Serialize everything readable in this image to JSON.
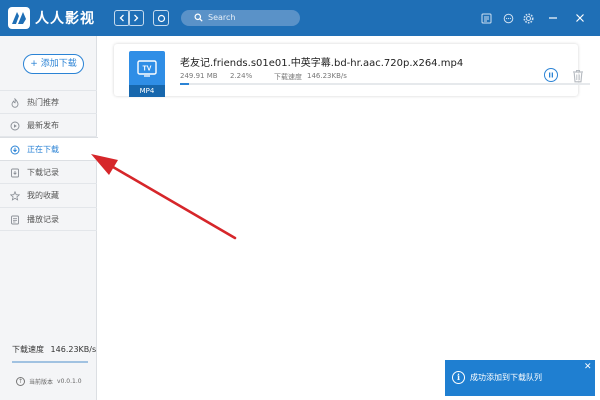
{
  "app": {
    "title": "人人影视"
  },
  "titlebar": {
    "search_placeholder": "Search",
    "icons": [
      "back-icon",
      "forward-icon",
      "refresh-icon",
      "search-icon",
      "download-history-icon",
      "message-icon",
      "settings-icon",
      "minimize-icon",
      "close-icon"
    ]
  },
  "sidebar": {
    "add_download": "+ 添加下载",
    "items": [
      {
        "label": "热门推荐",
        "icon": "flame-icon"
      },
      {
        "label": "最新发布",
        "icon": "play-circle-icon"
      },
      {
        "label": "正在下载",
        "icon": "download-circle-icon",
        "active": true
      },
      {
        "label": "下载记录",
        "icon": "history-icon"
      },
      {
        "label": "我的收藏",
        "icon": "star-icon"
      },
      {
        "label": "播放记录",
        "icon": "list-icon"
      }
    ],
    "speed_label": "下载速度",
    "speed_value": "146.23KB/s",
    "version_label": "当前版本",
    "version_value": "v0.0.1.0"
  },
  "download": {
    "filename": "老友记.friends.s01e01.中英字幕.bd-hr.aac.720p.x264.mp4",
    "size": "249.91 MB",
    "percent_text": "2.24%",
    "progress_fraction": 0.0224,
    "speed_label": "下载速度",
    "speed_value": "146.23KB/s",
    "format": "MP4"
  },
  "toast": {
    "message": "成功添加到下载队列",
    "close": "✕"
  },
  "colors": {
    "titlebar": "#1f6fb6",
    "accent": "#2b83d5",
    "toast": "#1f7fd1",
    "annotation_arrow": "#d6262a"
  }
}
